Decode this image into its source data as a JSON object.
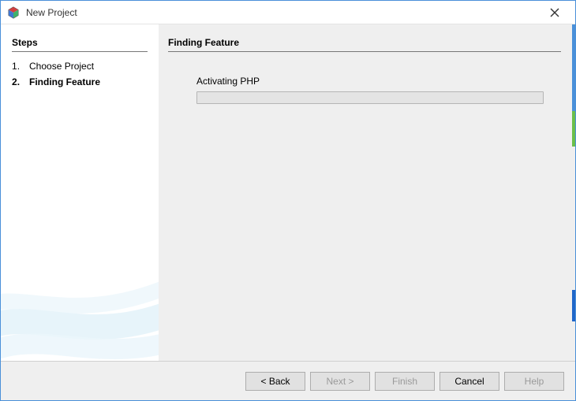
{
  "window": {
    "title": "New Project"
  },
  "sidebar": {
    "heading": "Steps",
    "steps": [
      {
        "label": "Choose Project",
        "current": false
      },
      {
        "label": "Finding Feature",
        "current": true
      }
    ]
  },
  "main": {
    "heading": "Finding Feature",
    "status": "Activating PHP",
    "progress_percent": 0
  },
  "footer": {
    "back": "< Back",
    "next": "Next >",
    "finish": "Finish",
    "cancel": "Cancel",
    "help": "Help"
  }
}
